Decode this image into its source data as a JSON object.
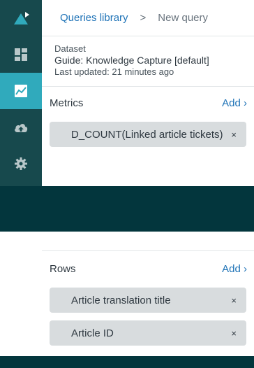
{
  "breadcrumb": {
    "library_link": "Queries library",
    "separator": ">",
    "current": "New query"
  },
  "dataset": {
    "label": "Dataset",
    "name": "Guide: Knowledge Capture [default]",
    "updated": "Last updated: 21 minutes ago"
  },
  "metrics": {
    "title": "Metrics",
    "add_label": "Add ›",
    "items": [
      {
        "label": "D_COUNT(Linked article tickets)",
        "remove": "×"
      }
    ]
  },
  "rows": {
    "title": "Rows",
    "add_label": "Add ›",
    "items": [
      {
        "label": "Article translation title",
        "remove": "×"
      },
      {
        "label": "Article ID",
        "remove": "×"
      }
    ]
  },
  "colors": {
    "sidebar": "#17494d",
    "active_nav": "#30aabc",
    "background": "#03363d",
    "link": "#1f73b7",
    "pill": "#d8dcde"
  },
  "icons": [
    "logo-icon",
    "dashboard-icon",
    "queries-icon",
    "upload-icon",
    "gear-icon"
  ]
}
